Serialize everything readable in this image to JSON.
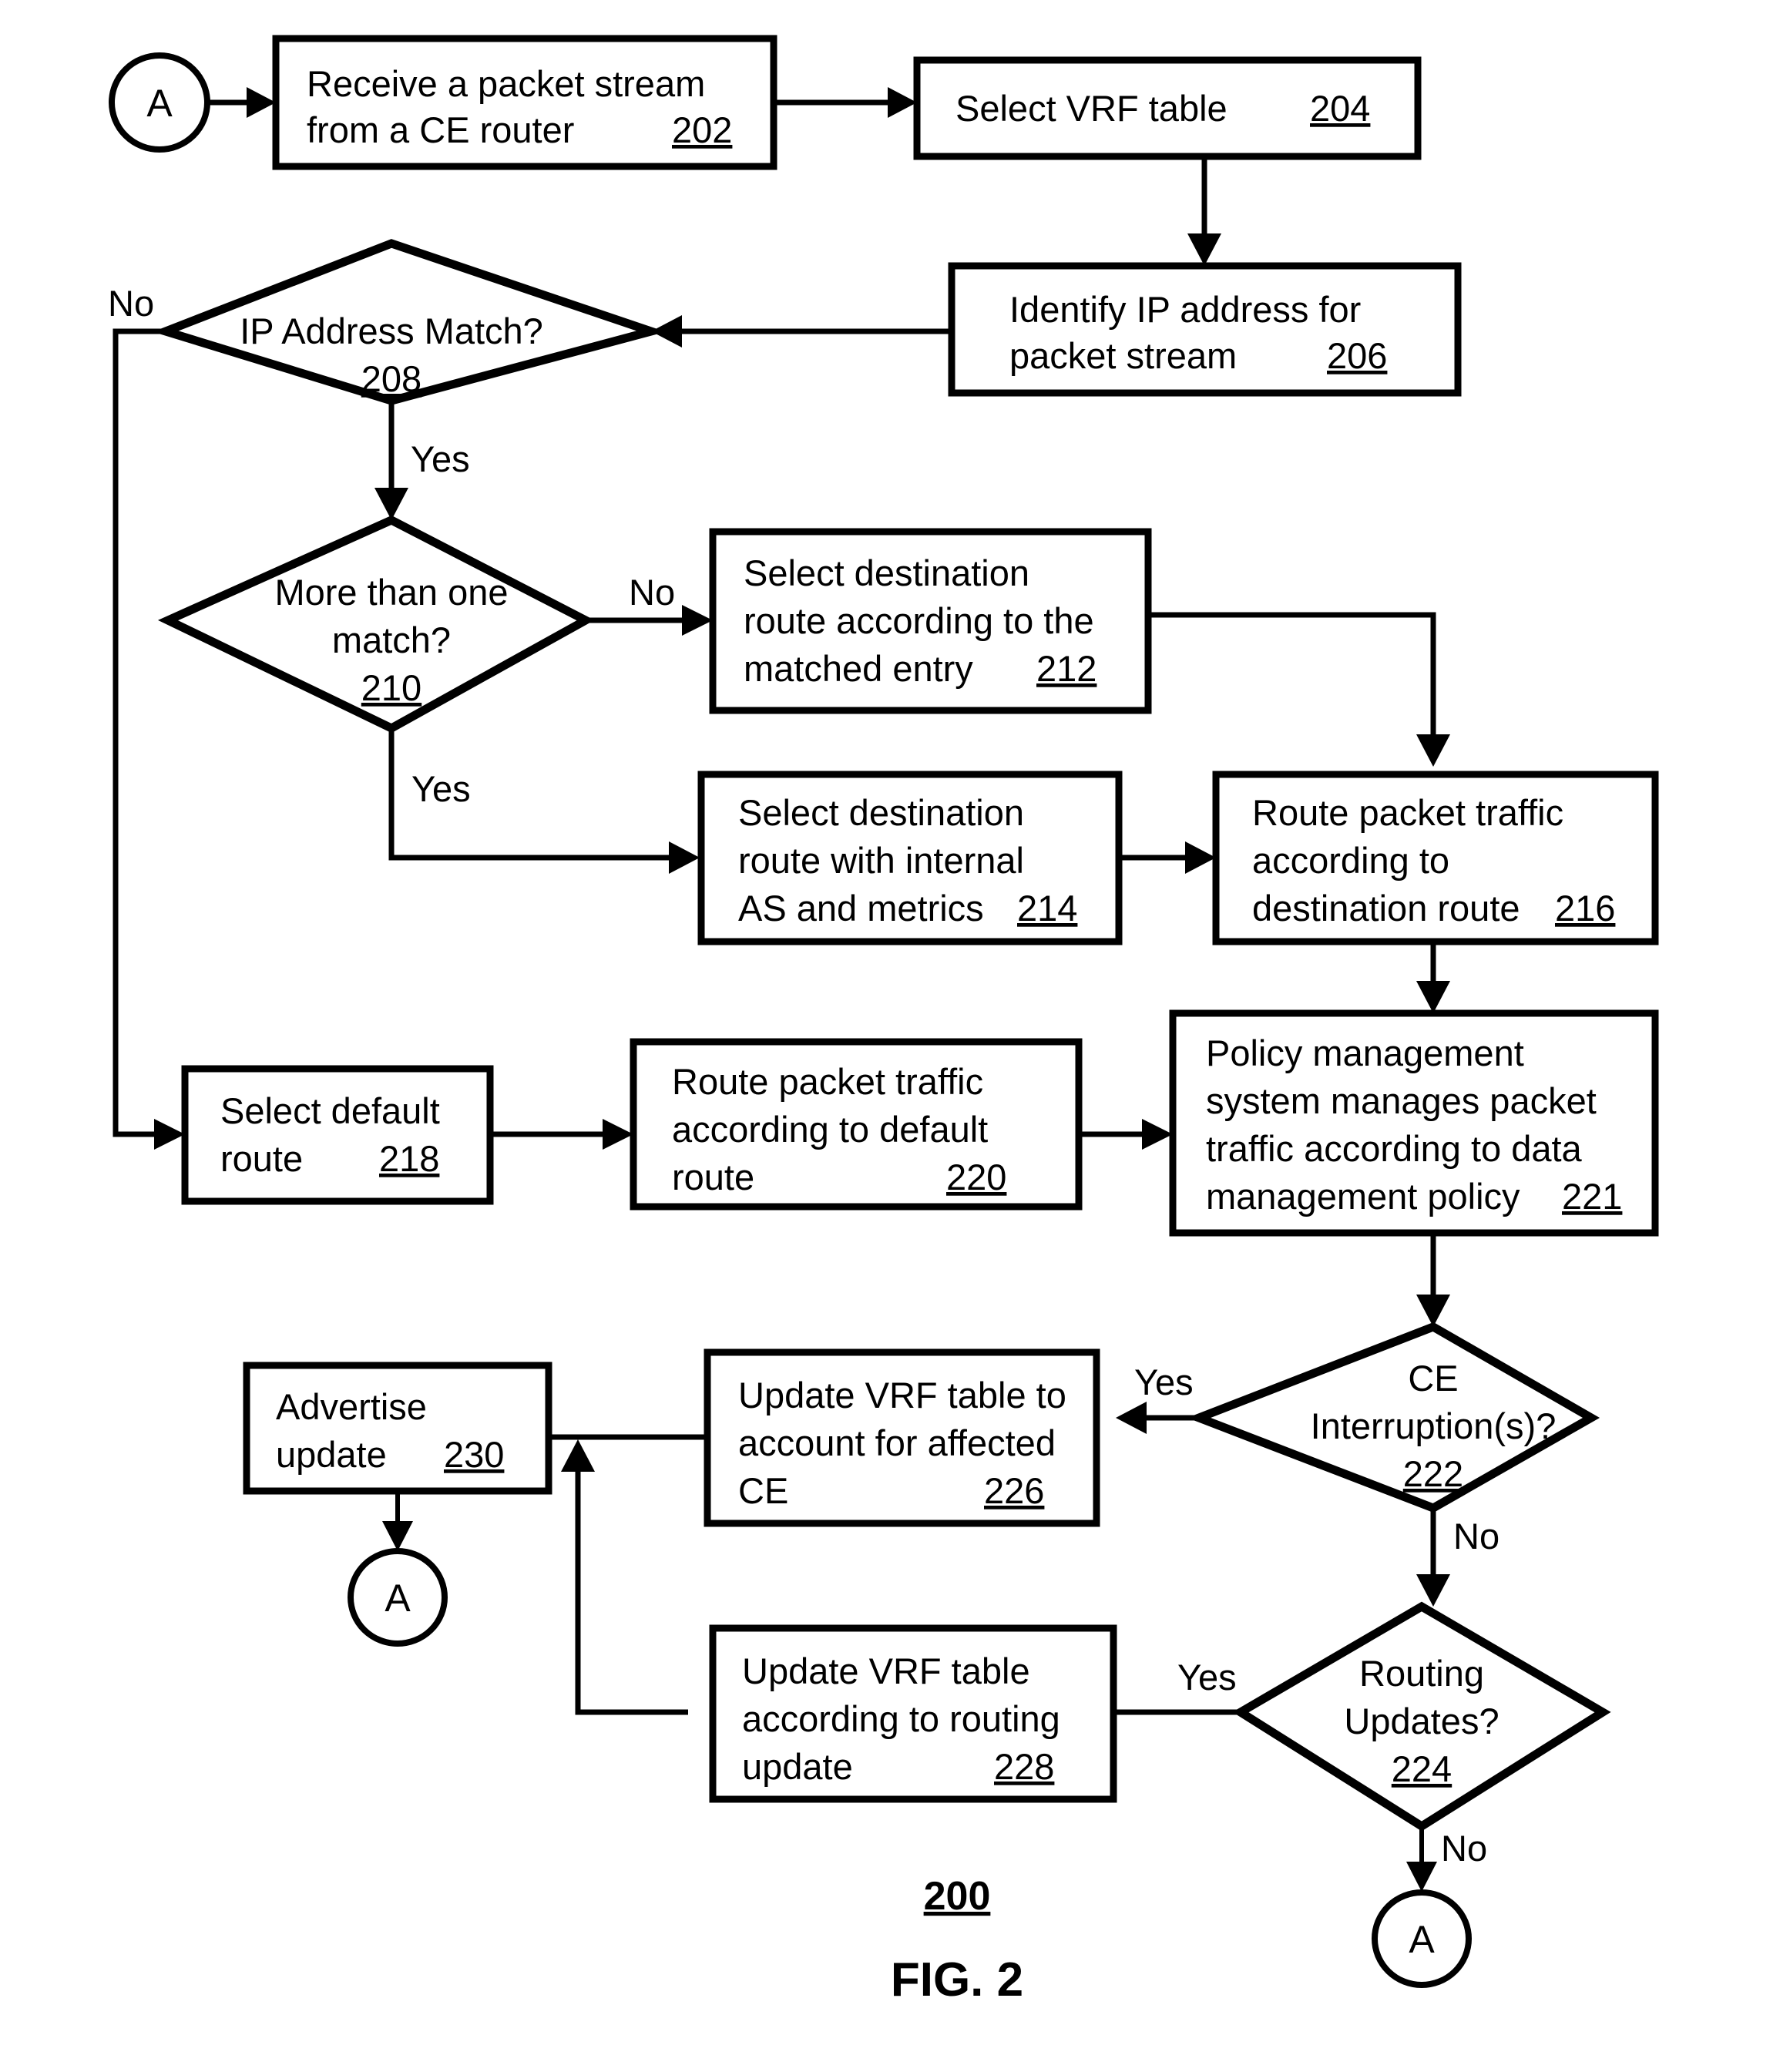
{
  "figure": {
    "number_label": "200",
    "caption": "FIG. 2"
  },
  "connectors": {
    "circle_a_top": "A",
    "circle_a_mid": "A",
    "circle_a_bottom": "A"
  },
  "nodes": {
    "n202": {
      "ref": "202",
      "line1": "Receive a packet stream",
      "line2": "from a CE router"
    },
    "n204": {
      "ref": "204",
      "line1": "Select VRF table"
    },
    "n206": {
      "ref": "206",
      "line1": "Identify IP address for",
      "line2": "packet stream"
    },
    "n208": {
      "ref": "208",
      "line1": "IP Address Match?"
    },
    "n210": {
      "ref": "210",
      "line1": "More than one",
      "line2": "match?"
    },
    "n212": {
      "ref": "212",
      "line1": "Select destination",
      "line2": "route according to the",
      "line3": "matched entry"
    },
    "n214": {
      "ref": "214",
      "line1": "Select destination",
      "line2": "route with internal",
      "line3": "AS and metrics"
    },
    "n216": {
      "ref": "216",
      "line1": "Route packet traffic",
      "line2": "according to",
      "line3": "destination route"
    },
    "n218": {
      "ref": "218",
      "line1": "Select default",
      "line2": "route"
    },
    "n220": {
      "ref": "220",
      "line1": "Route packet traffic",
      "line2": "according to default",
      "line3": "route"
    },
    "n221": {
      "ref": "221",
      "line1": "Policy management",
      "line2": "system manages packet",
      "line3": "traffic according to data",
      "line4": "management policy"
    },
    "n222": {
      "ref": "222",
      "line1": "CE",
      "line2": "Interruption(s)?"
    },
    "n224": {
      "ref": "224",
      "line1": "Routing",
      "line2": "Updates?"
    },
    "n226": {
      "ref": "226",
      "line1": "Update VRF table to",
      "line2": "account for affected",
      "line3": "CE"
    },
    "n228": {
      "ref": "228",
      "line1": "Update VRF table",
      "line2": "according to routing",
      "line3": "update"
    },
    "n230": {
      "ref": "230",
      "line1": "Advertise",
      "line2": "update"
    }
  },
  "edge_labels": {
    "no_208": "No",
    "yes_208": "Yes",
    "no_210": "No",
    "yes_210": "Yes",
    "yes_222": "Yes",
    "no_222": "No",
    "yes_224": "Yes",
    "no_224": "No"
  }
}
